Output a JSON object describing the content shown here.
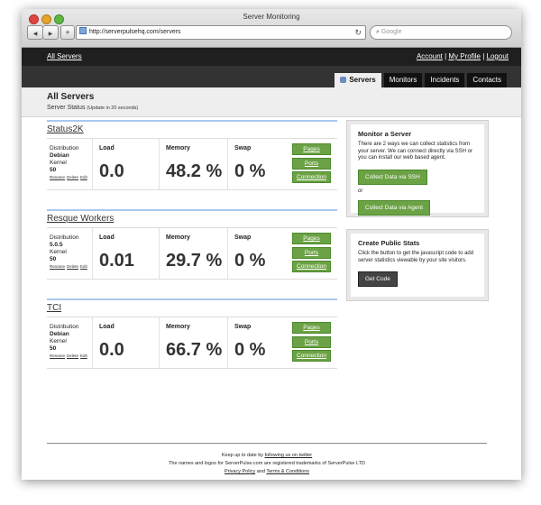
{
  "window": {
    "title": "Server Monitoring"
  },
  "browser": {
    "back": "◀",
    "forward": "▶",
    "add": "+",
    "url": "http://serverpulsehq.com/servers",
    "reload": "↻",
    "search_placeholder": "Google"
  },
  "topbar": {
    "all_servers": "All Servers",
    "account": "Account",
    "my_profile": "My Profile",
    "logout": "Logout",
    "sep": "|"
  },
  "nav": {
    "tabs": [
      "Servers",
      "Monitors",
      "Incidents",
      "Contacts"
    ]
  },
  "page": {
    "title": "All Servers",
    "subtitle": "Server Status",
    "update_note": "(Update in 20 seconds)"
  },
  "labels": {
    "distribution": "Distribution",
    "kernel": "Kernel",
    "load": "Load",
    "memory": "Memory",
    "swap": "Swap",
    "rename": "Rename",
    "delete": "Delete",
    "edit": "Edit",
    "pages": "Pages",
    "ports": "Ports",
    "connection": "Connection"
  },
  "servers": [
    {
      "name": "Status2K",
      "distribution": "Debian",
      "kernel": "50",
      "load": "0.0",
      "memory": "48.2 %",
      "swap": "0 %"
    },
    {
      "name": "Resque Workers",
      "distribution": "5.0.5",
      "kernel": "50",
      "load": "0.01",
      "memory": "29.7 %",
      "swap": "0 %"
    },
    {
      "name": "TCI",
      "distribution": "Debian",
      "kernel": "50",
      "load": "0.0",
      "memory": "66.7 %",
      "swap": "0 %"
    }
  ],
  "monitor_panel": {
    "title": "Monitor a Server",
    "text": "There are 2 ways we can collect statistics from your server. We can connect directly via SSH or you can install our web based agent.",
    "ssh_button": "Collect Data via SSH",
    "or": "or",
    "agent_button": "Collect Data via Agent"
  },
  "stats_panel": {
    "title": "Create Public Stats",
    "text": "Click the button to get the javascript code to add server statistics viewable by your site visitors.",
    "button": "Get Code"
  },
  "footer": {
    "line1_prefix": "Keep up to date by",
    "line1_link": "following us on twitter",
    "line2": "The names and logos for ServerPulse.com are registered trademarks of ServerPulse LTD",
    "privacy": "Privacy Policy",
    "and": "and",
    "terms": "Terms & Conditions"
  }
}
